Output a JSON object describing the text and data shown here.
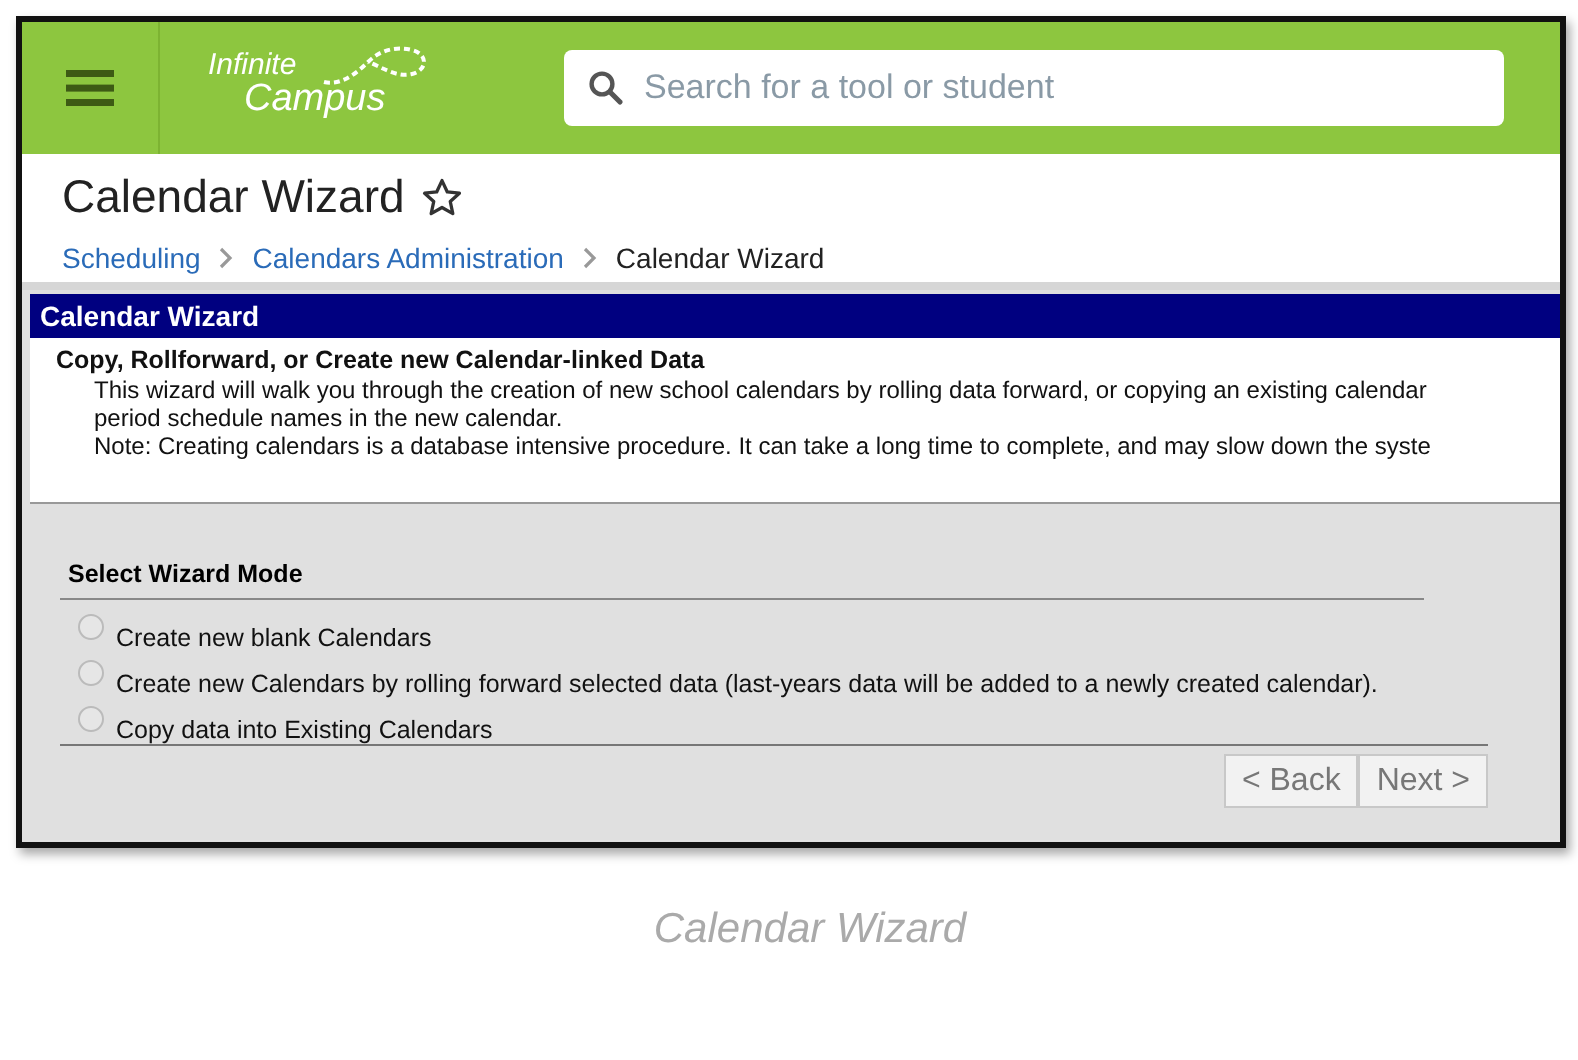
{
  "header": {
    "logo": {
      "line_1": "Infinite",
      "line_2": "Campus"
    },
    "search": {
      "placeholder": "Search for a tool or student"
    }
  },
  "page": {
    "title": "Calendar Wizard",
    "favorite": false
  },
  "breadcrumbs": [
    {
      "label": "Scheduling",
      "link": true
    },
    {
      "label": "Calendars Administration",
      "link": true
    },
    {
      "label": "Calendar Wizard",
      "link": false
    }
  ],
  "panel": {
    "title": "Calendar Wizard",
    "heading": "Copy, Rollforward, or Create new Calendar-linked Data",
    "lines": [
      "This wizard will walk you through the creation of new school calendars by rolling data forward, or copying an existing calendar",
      "period schedule names in the new calendar.",
      "Note: Creating calendars is a database intensive procedure. It can take a long time to complete, and may slow down the syste"
    ]
  },
  "mode": {
    "title": "Select Wizard Mode",
    "options": [
      {
        "label": "Create new blank Calendars",
        "selected": false
      },
      {
        "label": "Create new Calendars by rolling forward selected data (last-years data will be added to a newly created calendar).",
        "selected": false
      },
      {
        "label": "Copy data into Existing Calendars",
        "selected": false
      }
    ]
  },
  "buttons": [
    "< Back",
    "Next >"
  ],
  "caption": "Calendar Wizard"
}
